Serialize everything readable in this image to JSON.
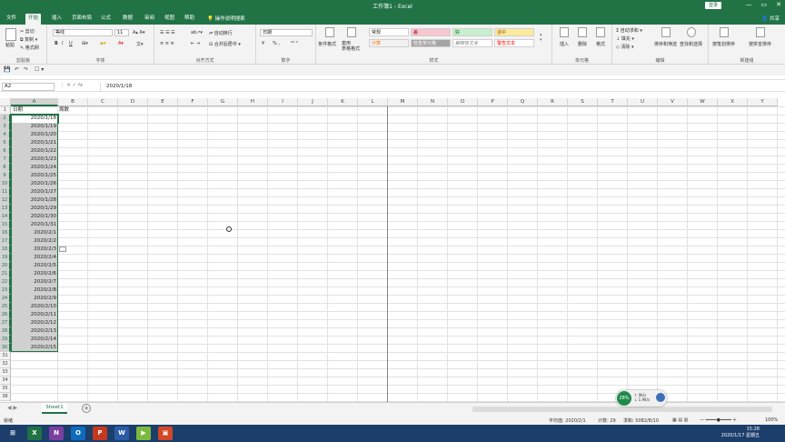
{
  "window": {
    "title": "工作簿1 - Excel",
    "login_label": "登录",
    "controls": [
      "—",
      "▭",
      "✕"
    ]
  },
  "tabs": [
    "文件",
    "开始",
    "插入",
    "页面布局",
    "公式",
    "数据",
    "审阅",
    "视图",
    "帮助"
  ],
  "active_tab": 1,
  "tell_me": "操作说明搜索",
  "share_label": "共享",
  "ribbon": {
    "clipboard": {
      "label": "剪贴板",
      "paste": "粘贴",
      "cut": "✂ 剪切",
      "copy": "⧉ 复制 ▾",
      "format_painter": "✎ 格式刷"
    },
    "font": {
      "label": "字体",
      "name": "等线",
      "size": "11",
      "bold": "B",
      "italic": "I",
      "underline": "U"
    },
    "align": {
      "label": "对齐方式",
      "wrap": "自动换行",
      "merge": "合并后居中 ▾"
    },
    "number": {
      "label": "数字",
      "format": "日期",
      "percent": "% ,",
      "currency": "¥"
    },
    "styles": {
      "label": "样式",
      "cond_format": "条件格式",
      "table_format": "套用\n表格格式",
      "cells": [
        {
          "name": "常规",
          "bg": "#ffffff",
          "fg": "#222222"
        },
        {
          "name": "差",
          "bg": "#f7c6ce",
          "fg": "#9c0006"
        },
        {
          "name": "好",
          "bg": "#c6efce",
          "fg": "#006100"
        },
        {
          "name": "适中",
          "bg": "#ffeb9c",
          "fg": "#9c5700"
        },
        {
          "name": "计算",
          "bg": "#f2f2f2",
          "fg": "#fa7d00"
        },
        {
          "name": "检查单元格",
          "bg": "#a5a5a5",
          "fg": "#ffffff"
        },
        {
          "name": "解释性文本",
          "bg": "#ffffff",
          "fg": "#7f7f7f"
        },
        {
          "name": "警告文本",
          "bg": "#ffffff",
          "fg": "#ff0000"
        }
      ]
    },
    "cells_group": {
      "label": "单元格",
      "insert": "插入",
      "delete": "删除",
      "format": "格式"
    },
    "editing": {
      "label": "编辑",
      "autosum": "Σ 自动求和 ▾",
      "fill": "↓ 填充 ▾",
      "clear": "◇ 清除 ▾",
      "sort": "排序和筛选",
      "find": "查找和选择"
    },
    "addins": {
      "label": "新建组",
      "a": "按笔划排序",
      "b": "按拼音排序"
    }
  },
  "qat": {
    "save": "💾",
    "undo": "↶",
    "redo": "↷",
    "other": "☐ ▾"
  },
  "formula_bar": {
    "name_box": "A2",
    "icons": "⋮  ✕  ✓  fx",
    "value": "2020/1/18"
  },
  "columns": [
    "A",
    "B",
    "C",
    "D",
    "E",
    "F",
    "G",
    "H",
    "I",
    "J",
    "K",
    "L",
    "M",
    "N",
    "O",
    "P",
    "Q",
    "R",
    "S",
    "T",
    "U",
    "V",
    "W",
    "X",
    "Y"
  ],
  "rows": [
    "1",
    "2",
    "3",
    "4",
    "5",
    "6",
    "7",
    "8",
    "9",
    "10",
    "11",
    "12",
    "13",
    "14",
    "15",
    "16",
    "17",
    "18",
    "19",
    "20",
    "21",
    "22",
    "23",
    "24",
    "25",
    "26",
    "27",
    "28",
    "29",
    "30",
    "31",
    "32",
    "33",
    "34",
    "35",
    "36"
  ],
  "header_cells": {
    "A1": "日期",
    "B1": "周数"
  },
  "dates": [
    "2020/1/18",
    "2020/1/19",
    "2020/1/20",
    "2020/1/21",
    "2020/1/22",
    "2020/1/23",
    "2020/1/24",
    "2020/1/25",
    "2020/1/26",
    "2020/1/27",
    "2020/1/28",
    "2020/1/29",
    "2020/1/30",
    "2020/1/31",
    "2020/2/1",
    "2020/2/2",
    "2020/2/3",
    "2020/2/4",
    "2020/2/5",
    "2020/2/6",
    "2020/2/7",
    "2020/2/8",
    "2020/2/9",
    "2020/2/10",
    "2020/2/11",
    "2020/2/12",
    "2020/2/13",
    "2020/2/14",
    "2020/2/15"
  ],
  "sheet": {
    "nav": "◀ ▶",
    "tab": "Sheet1",
    "add": "+"
  },
  "status": {
    "mode": "就绪",
    "average": "平均值: 2020/2/1",
    "count": "计数: 29",
    "sum": "求和: 5082/8/10",
    "zoom": "100%"
  },
  "widget": {
    "percent": "28%",
    "line1": "↑  0K/s",
    "line2": "↓  1.9K/s"
  },
  "taskbar": {
    "apps": [
      {
        "label": "⊞",
        "color": "#1c3e6b"
      },
      {
        "label": "X",
        "color": "#1f7244"
      },
      {
        "label": "N",
        "color": "#7b3fa0"
      },
      {
        "label": "O",
        "color": "#0f6cbd"
      },
      {
        "label": "P",
        "color": "#c4391d"
      },
      {
        "label": "W",
        "color": "#2b5aa7"
      },
      {
        "label": "▶",
        "color": "#7db93f"
      },
      {
        "label": "▣",
        "color": "#d24726"
      }
    ],
    "time": "15:28",
    "date": "2020/1/17 星期五"
  }
}
